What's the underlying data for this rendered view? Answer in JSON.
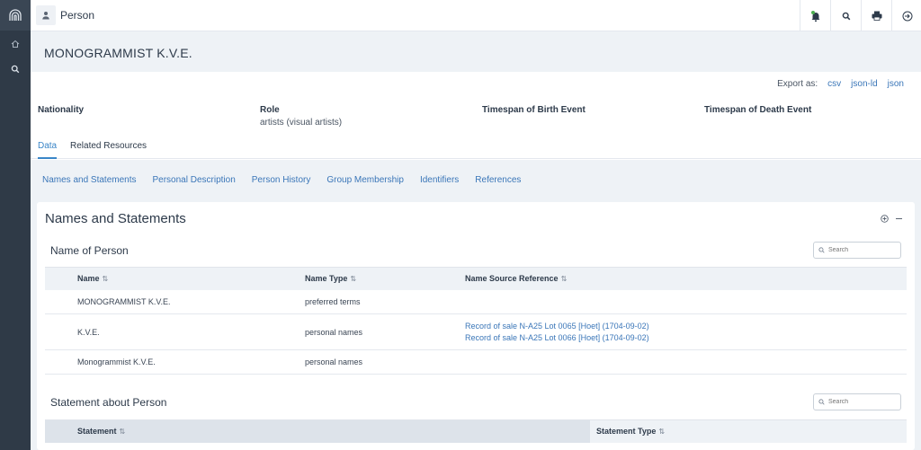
{
  "topbar": {
    "type_label": "Person"
  },
  "header": {
    "title": "MONOGRAMMIST K.V.E."
  },
  "export": {
    "label": "Export as:",
    "formats": [
      "csv",
      "json-ld",
      "json"
    ]
  },
  "fields": [
    {
      "key": "Nationality",
      "value": ""
    },
    {
      "key": "Role",
      "value": "artists (visual artists)"
    },
    {
      "key": "Timespan of Birth Event",
      "value": ""
    },
    {
      "key": "Timespan of Death Event",
      "value": ""
    }
  ],
  "tabs": [
    {
      "label": "Data",
      "active": true
    },
    {
      "label": "Related Resources",
      "active": false
    }
  ],
  "sublinks": [
    "Names and Statements",
    "Personal Description",
    "Person History",
    "Group Membership",
    "Identifiers",
    "References"
  ],
  "card": {
    "title": "Names and Statements"
  },
  "names_section": {
    "title": "Name of Person",
    "search_placeholder": "Search",
    "columns": [
      "Name",
      "Name Type",
      "Name Source Reference"
    ],
    "rows": [
      {
        "name": "MONOGRAMMIST K.V.E.",
        "type": "preferred terms",
        "refs": []
      },
      {
        "name": "K.V.E.",
        "type": "personal names",
        "refs": [
          "Record of sale N-A25 Lot 0065 [Hoet] (1704-09-02)",
          "Record of sale N-A25 Lot 0066 [Hoet] (1704-09-02)"
        ]
      },
      {
        "name": "Monogrammist K.V.E.",
        "type": "personal names",
        "refs": []
      }
    ]
  },
  "statements_section": {
    "title": "Statement about Person",
    "search_placeholder": "Search",
    "columns": [
      "Statement",
      "Statement Type"
    ]
  },
  "sort_glyph": "⇅",
  "colors": {
    "rail": "#2f3a47",
    "link": "#3a76b8",
    "band": "#eef2f6"
  }
}
